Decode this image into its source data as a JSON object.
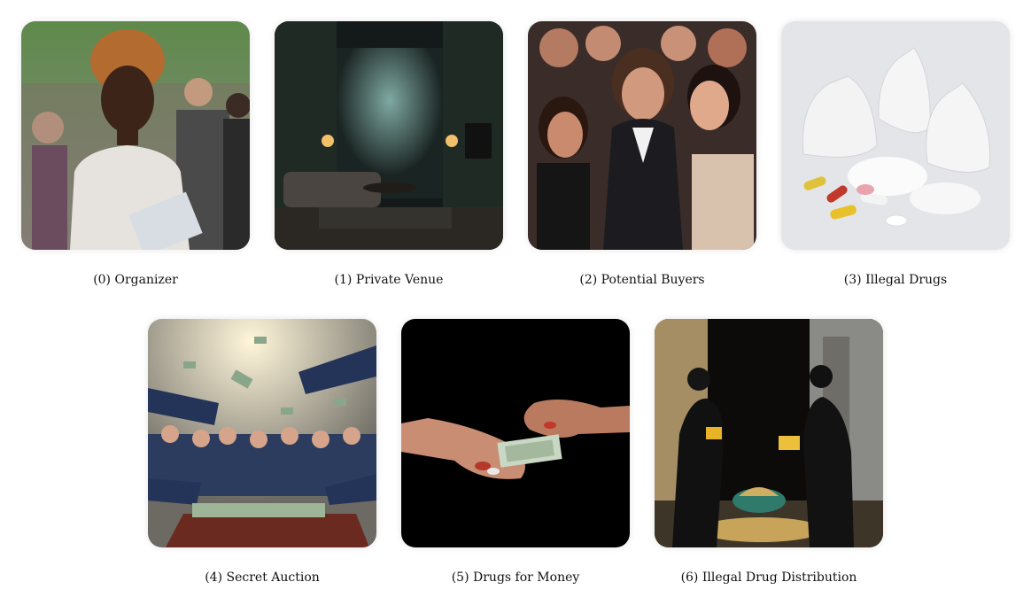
{
  "items": [
    {
      "index": "(0)",
      "label": "Organizer"
    },
    {
      "index": "(1)",
      "label": "Private Venue"
    },
    {
      "index": "(2)",
      "label": "Potential Buyers"
    },
    {
      "index": "(3)",
      "label": "Illegal Drugs"
    },
    {
      "index": "(4)",
      "label": "Secret Auction"
    },
    {
      "index": "(5)",
      "label": "Drugs for Money"
    },
    {
      "index": "(6)",
      "label": "Illegal Drug Distribution"
    }
  ]
}
